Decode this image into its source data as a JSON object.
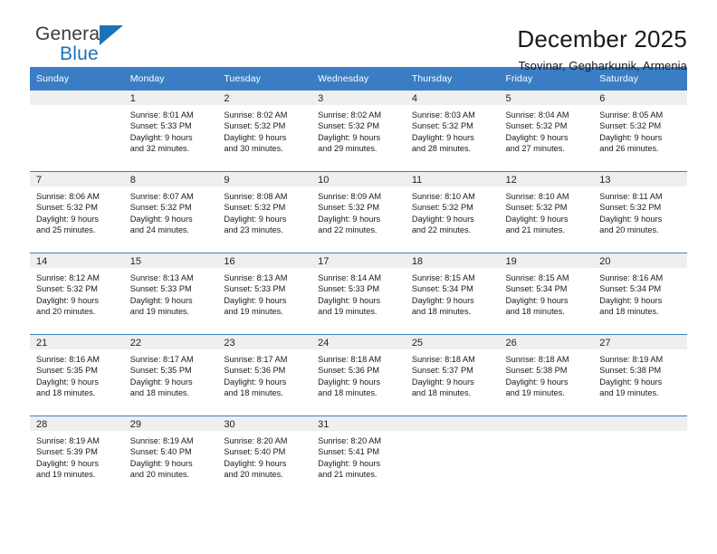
{
  "brand": {
    "word_one": "General",
    "word_two": "Blue",
    "triangle_color": "#1a72b8"
  },
  "header": {
    "title": "December 2025",
    "subtitle": "Tsovinar, Gegharkunik, Armenia",
    "header_bg": "#3b7dc4"
  },
  "calendar": {
    "weekdays": [
      "Sunday",
      "Monday",
      "Tuesday",
      "Wednesday",
      "Thursday",
      "Friday",
      "Saturday"
    ],
    "weeks": [
      [
        {
          "day": "",
          "sunrise": "",
          "sunset": "",
          "daylight_1": "",
          "daylight_2": ""
        },
        {
          "day": "1",
          "sunrise": "Sunrise: 8:01 AM",
          "sunset": "Sunset: 5:33 PM",
          "daylight_1": "Daylight: 9 hours",
          "daylight_2": "and 32 minutes."
        },
        {
          "day": "2",
          "sunrise": "Sunrise: 8:02 AM",
          "sunset": "Sunset: 5:32 PM",
          "daylight_1": "Daylight: 9 hours",
          "daylight_2": "and 30 minutes."
        },
        {
          "day": "3",
          "sunrise": "Sunrise: 8:02 AM",
          "sunset": "Sunset: 5:32 PM",
          "daylight_1": "Daylight: 9 hours",
          "daylight_2": "and 29 minutes."
        },
        {
          "day": "4",
          "sunrise": "Sunrise: 8:03 AM",
          "sunset": "Sunset: 5:32 PM",
          "daylight_1": "Daylight: 9 hours",
          "daylight_2": "and 28 minutes."
        },
        {
          "day": "5",
          "sunrise": "Sunrise: 8:04 AM",
          "sunset": "Sunset: 5:32 PM",
          "daylight_1": "Daylight: 9 hours",
          "daylight_2": "and 27 minutes."
        },
        {
          "day": "6",
          "sunrise": "Sunrise: 8:05 AM",
          "sunset": "Sunset: 5:32 PM",
          "daylight_1": "Daylight: 9 hours",
          "daylight_2": "and 26 minutes."
        }
      ],
      [
        {
          "day": "7",
          "sunrise": "Sunrise: 8:06 AM",
          "sunset": "Sunset: 5:32 PM",
          "daylight_1": "Daylight: 9 hours",
          "daylight_2": "and 25 minutes."
        },
        {
          "day": "8",
          "sunrise": "Sunrise: 8:07 AM",
          "sunset": "Sunset: 5:32 PM",
          "daylight_1": "Daylight: 9 hours",
          "daylight_2": "and 24 minutes."
        },
        {
          "day": "9",
          "sunrise": "Sunrise: 8:08 AM",
          "sunset": "Sunset: 5:32 PM",
          "daylight_1": "Daylight: 9 hours",
          "daylight_2": "and 23 minutes."
        },
        {
          "day": "10",
          "sunrise": "Sunrise: 8:09 AM",
          "sunset": "Sunset: 5:32 PM",
          "daylight_1": "Daylight: 9 hours",
          "daylight_2": "and 22 minutes."
        },
        {
          "day": "11",
          "sunrise": "Sunrise: 8:10 AM",
          "sunset": "Sunset: 5:32 PM",
          "daylight_1": "Daylight: 9 hours",
          "daylight_2": "and 22 minutes."
        },
        {
          "day": "12",
          "sunrise": "Sunrise: 8:10 AM",
          "sunset": "Sunset: 5:32 PM",
          "daylight_1": "Daylight: 9 hours",
          "daylight_2": "and 21 minutes."
        },
        {
          "day": "13",
          "sunrise": "Sunrise: 8:11 AM",
          "sunset": "Sunset: 5:32 PM",
          "daylight_1": "Daylight: 9 hours",
          "daylight_2": "and 20 minutes."
        }
      ],
      [
        {
          "day": "14",
          "sunrise": "Sunrise: 8:12 AM",
          "sunset": "Sunset: 5:32 PM",
          "daylight_1": "Daylight: 9 hours",
          "daylight_2": "and 20 minutes."
        },
        {
          "day": "15",
          "sunrise": "Sunrise: 8:13 AM",
          "sunset": "Sunset: 5:33 PM",
          "daylight_1": "Daylight: 9 hours",
          "daylight_2": "and 19 minutes."
        },
        {
          "day": "16",
          "sunrise": "Sunrise: 8:13 AM",
          "sunset": "Sunset: 5:33 PM",
          "daylight_1": "Daylight: 9 hours",
          "daylight_2": "and 19 minutes."
        },
        {
          "day": "17",
          "sunrise": "Sunrise: 8:14 AM",
          "sunset": "Sunset: 5:33 PM",
          "daylight_1": "Daylight: 9 hours",
          "daylight_2": "and 19 minutes."
        },
        {
          "day": "18",
          "sunrise": "Sunrise: 8:15 AM",
          "sunset": "Sunset: 5:34 PM",
          "daylight_1": "Daylight: 9 hours",
          "daylight_2": "and 18 minutes."
        },
        {
          "day": "19",
          "sunrise": "Sunrise: 8:15 AM",
          "sunset": "Sunset: 5:34 PM",
          "daylight_1": "Daylight: 9 hours",
          "daylight_2": "and 18 minutes."
        },
        {
          "day": "20",
          "sunrise": "Sunrise: 8:16 AM",
          "sunset": "Sunset: 5:34 PM",
          "daylight_1": "Daylight: 9 hours",
          "daylight_2": "and 18 minutes."
        }
      ],
      [
        {
          "day": "21",
          "sunrise": "Sunrise: 8:16 AM",
          "sunset": "Sunset: 5:35 PM",
          "daylight_1": "Daylight: 9 hours",
          "daylight_2": "and 18 minutes."
        },
        {
          "day": "22",
          "sunrise": "Sunrise: 8:17 AM",
          "sunset": "Sunset: 5:35 PM",
          "daylight_1": "Daylight: 9 hours",
          "daylight_2": "and 18 minutes."
        },
        {
          "day": "23",
          "sunrise": "Sunrise: 8:17 AM",
          "sunset": "Sunset: 5:36 PM",
          "daylight_1": "Daylight: 9 hours",
          "daylight_2": "and 18 minutes."
        },
        {
          "day": "24",
          "sunrise": "Sunrise: 8:18 AM",
          "sunset": "Sunset: 5:36 PM",
          "daylight_1": "Daylight: 9 hours",
          "daylight_2": "and 18 minutes."
        },
        {
          "day": "25",
          "sunrise": "Sunrise: 8:18 AM",
          "sunset": "Sunset: 5:37 PM",
          "daylight_1": "Daylight: 9 hours",
          "daylight_2": "and 18 minutes."
        },
        {
          "day": "26",
          "sunrise": "Sunrise: 8:18 AM",
          "sunset": "Sunset: 5:38 PM",
          "daylight_1": "Daylight: 9 hours",
          "daylight_2": "and 19 minutes."
        },
        {
          "day": "27",
          "sunrise": "Sunrise: 8:19 AM",
          "sunset": "Sunset: 5:38 PM",
          "daylight_1": "Daylight: 9 hours",
          "daylight_2": "and 19 minutes."
        }
      ],
      [
        {
          "day": "28",
          "sunrise": "Sunrise: 8:19 AM",
          "sunset": "Sunset: 5:39 PM",
          "daylight_1": "Daylight: 9 hours",
          "daylight_2": "and 19 minutes."
        },
        {
          "day": "29",
          "sunrise": "Sunrise: 8:19 AM",
          "sunset": "Sunset: 5:40 PM",
          "daylight_1": "Daylight: 9 hours",
          "daylight_2": "and 20 minutes."
        },
        {
          "day": "30",
          "sunrise": "Sunrise: 8:20 AM",
          "sunset": "Sunset: 5:40 PM",
          "daylight_1": "Daylight: 9 hours",
          "daylight_2": "and 20 minutes."
        },
        {
          "day": "31",
          "sunrise": "Sunrise: 8:20 AM",
          "sunset": "Sunset: 5:41 PM",
          "daylight_1": "Daylight: 9 hours",
          "daylight_2": "and 21 minutes."
        },
        {
          "day": "",
          "sunrise": "",
          "sunset": "",
          "daylight_1": "",
          "daylight_2": ""
        },
        {
          "day": "",
          "sunrise": "",
          "sunset": "",
          "daylight_1": "",
          "daylight_2": ""
        },
        {
          "day": "",
          "sunrise": "",
          "sunset": "",
          "daylight_1": "",
          "daylight_2": ""
        }
      ]
    ]
  }
}
